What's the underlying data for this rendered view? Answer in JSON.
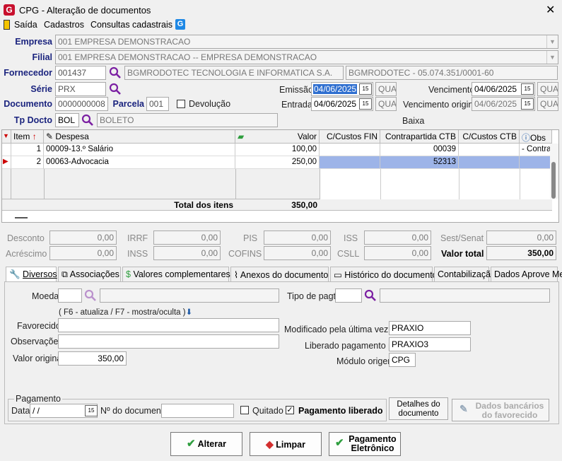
{
  "window": {
    "title": "CPG - Alteração de documentos",
    "icon": "G"
  },
  "menu": {
    "items": [
      "Saída",
      "Cadastros",
      "Consultas cadastrais"
    ]
  },
  "form": {
    "empresa": {
      "label": "Empresa",
      "value": "001 EMPRESA DEMONSTRACAO"
    },
    "filial": {
      "label": "Filial",
      "value": "001 EMPRESA DEMONSTRACAO -- EMPRESA DEMONSTRACAO"
    },
    "fornecedor": {
      "label": "Fornecedor",
      "code": "001437",
      "name": "BGMRODOTEC TECNOLOGIA E INFORMATICA S.A.",
      "doc": "BGMRODOTEC - 05.074.351/0001-60"
    },
    "serie": {
      "label": "Série",
      "value": "PRX"
    },
    "documento": {
      "label": "Documento",
      "value": "0000000008"
    },
    "parcela": {
      "label": "Parcela",
      "value": "001"
    },
    "devolucao": {
      "label": "Devolução",
      "checked": false
    },
    "tp_docto": {
      "label": "Tp Docto",
      "code": "BOL",
      "desc": "BOLETO"
    },
    "emissao": {
      "label": "Emissão",
      "date": "04/06/2025",
      "weekday": "QUA"
    },
    "entrada": {
      "label": "Entrada",
      "date": "04/06/2025",
      "weekday": "QUA"
    },
    "vencimento": {
      "label": "Vencimento",
      "date": "04/06/2025",
      "weekday": "QUA"
    },
    "vencimento_original": {
      "label": "Vencimento original",
      "date": "04/06/2025",
      "weekday": "QUA"
    },
    "baixa": {
      "label": "Baixa"
    }
  },
  "grid": {
    "headers": [
      "Item",
      "Despesa",
      "Valor",
      "C/Custos FIN",
      "Contrapartida CTB",
      "C/Custos CTB",
      "Obs"
    ],
    "rows": [
      {
        "item": "1",
        "despesa": "00009-13.º Salário",
        "valor": "100,00",
        "cc_fin": "",
        "contrapartida": "00039",
        "cc_ctb": "",
        "obs": "- Contra"
      },
      {
        "item": "2",
        "despesa": "00063-Advocacia",
        "valor": "250,00",
        "cc_fin": "",
        "contrapartida": "52313",
        "cc_ctb": "",
        "obs": ""
      }
    ],
    "total_label": "Total dos itens",
    "total_value": "350,00"
  },
  "totals": {
    "desconto": {
      "label": "Desconto",
      "value": "0,00"
    },
    "acrescimo": {
      "label": "Acréscimo",
      "value": "0,00"
    },
    "irrf": {
      "label": "IRRF",
      "value": "0,00"
    },
    "inss": {
      "label": "INSS",
      "value": "0,00"
    },
    "pis": {
      "label": "PIS",
      "value": "0,00"
    },
    "cofins": {
      "label": "COFINS",
      "value": "0,00"
    },
    "iss": {
      "label": "ISS",
      "value": "0,00"
    },
    "csll": {
      "label": "CSLL",
      "value": "0,00"
    },
    "sest": {
      "label": "Sest/Senat",
      "value": "0,00"
    },
    "valor_total": {
      "label": "Valor total",
      "value": "350,00"
    }
  },
  "tabs": [
    "Diversos",
    "Associações",
    "Valores complementares",
    "Anexos do documento",
    "Histórico do documento",
    "Contabilização",
    "Dados Aprove Me"
  ],
  "diversos": {
    "moeda_label": "Moeda",
    "tipo_pagto_label": "Tipo de pagto",
    "hint": "( F6 - atualiza / F7 - mostra/oculta )",
    "favorecido_label": "Favorecido",
    "observacoes_label": "Observações",
    "valor_original_label": "Valor original",
    "valor_original": "350,00",
    "modificado_label": "Modificado pela última vez por",
    "modificado_value": "PRAXIO",
    "liberado_label": "Liberado pagamento por",
    "liberado_value": "PRAXIO3",
    "modulo_label": "Módulo origem",
    "modulo_value": "CPG"
  },
  "pagamento": {
    "group_label": "Pagamento",
    "data_label": "Data",
    "data_value": " /  /",
    "ndoc_label": "Nº do documento",
    "quitado_label": "Quitado",
    "liberado_label": "Pagamento liberado",
    "detalhes_label": "Detalhes do documento",
    "dados_bancarios_label": "Dados bancários do favorecido"
  },
  "buttons": {
    "alterar": "Alterar",
    "limpar": "Limpar",
    "pagamento": "Pagamento Eletrônico"
  },
  "colors": {
    "label_blue": "#1a237e",
    "selection": "#9db4e8",
    "magnifier": "#7b1fa2",
    "check_green": "#2e9e3e"
  }
}
